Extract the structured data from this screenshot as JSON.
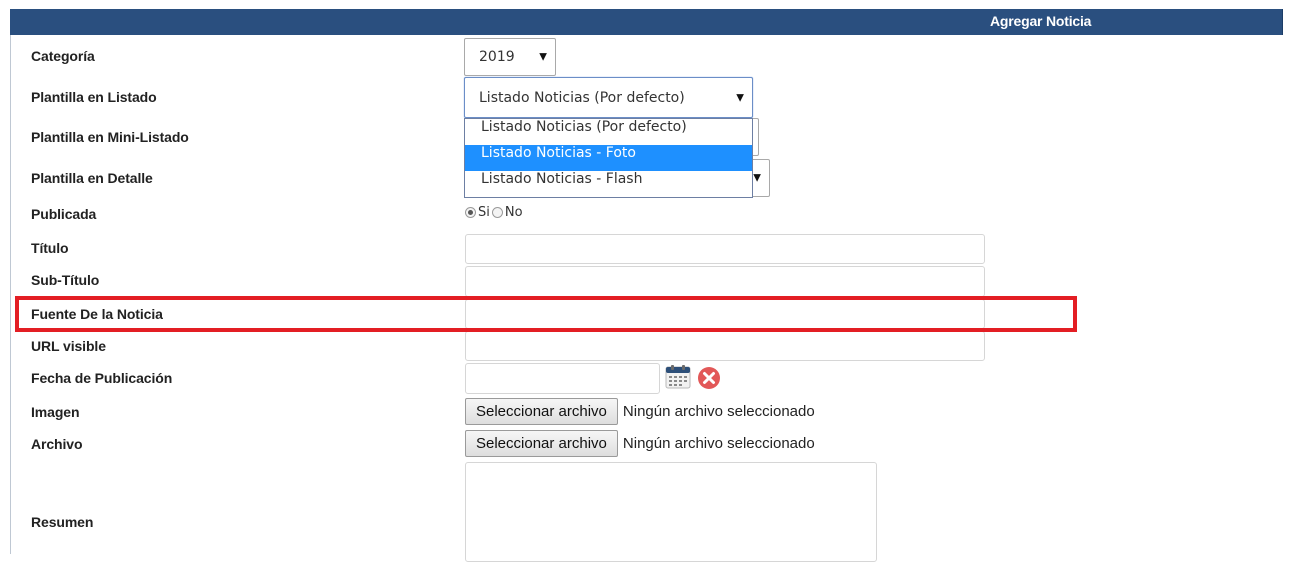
{
  "header": {
    "title": "Agregar Noticia",
    "background": "#2a4f7f"
  },
  "fields": {
    "categoria": {
      "label": "Categoría",
      "value": "2019"
    },
    "plantilla_listado": {
      "label": "Plantilla en Listado",
      "value": "Listado Noticias (Por defecto)",
      "options": [
        "Listado Noticias (Por defecto)",
        "Listado Noticias - Foto",
        "Listado Noticias - Flash"
      ],
      "highlighted_option": "Listado Noticias - Foto"
    },
    "plantilla_mini_listado": {
      "label": "Plantilla en Mini-Listado"
    },
    "plantilla_detalle": {
      "label": "Plantilla en Detalle"
    },
    "publicada": {
      "label": "Publicada",
      "options": [
        "Si",
        "No"
      ],
      "selected": "Si"
    },
    "titulo": {
      "label": "Título",
      "value": ""
    },
    "subtitulo": {
      "label": "Sub-Título",
      "value": ""
    },
    "fuente": {
      "label": "Fuente De la Noticia",
      "value": ""
    },
    "url_visible": {
      "label": "URL visible",
      "value": ""
    },
    "fecha_publicacion": {
      "label": "Fecha de Publicación",
      "value": ""
    },
    "imagen": {
      "label": "Imagen",
      "button": "Seleccionar archivo",
      "status": "Ningún archivo seleccionado"
    },
    "archivo": {
      "label": "Archivo",
      "button": "Seleccionar archivo",
      "status": "Ningún archivo seleccionado"
    },
    "resumen": {
      "label": "Resumen",
      "value": ""
    }
  },
  "icons": {
    "calendar": "calendar-icon",
    "clear": "clear-icon"
  },
  "colors": {
    "highlight": "#e31e24",
    "selected_option": "#1e90ff",
    "clear_icon": "#e25858"
  }
}
